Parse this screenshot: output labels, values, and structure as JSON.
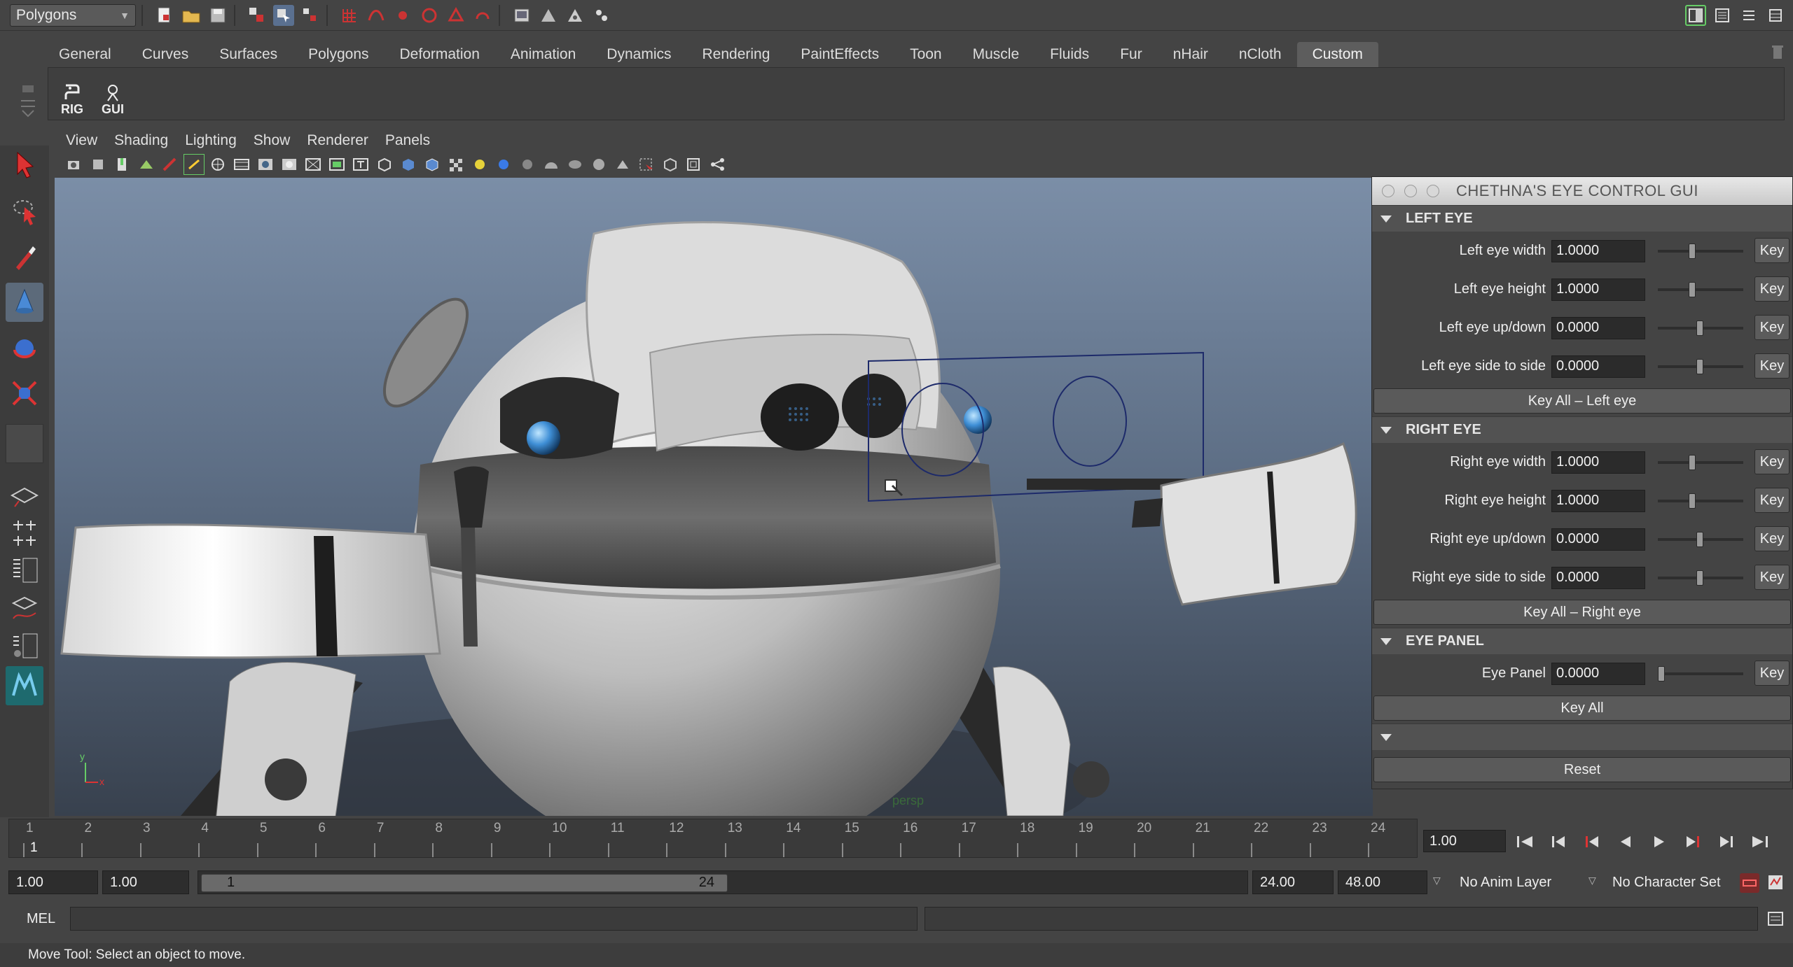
{
  "status_line": {
    "menu_set": "Polygons",
    "icons": [
      "new-scene-icon",
      "open-scene-icon",
      "save-scene-icon",
      "select-hierarchy-icon",
      "select-object-icon",
      "select-component-icon",
      "snap-grid-icon",
      "snap-curve-icon",
      "snap-point-icon",
      "snap-view-plane-icon",
      "snap-live-icon",
      "make-live-icon",
      "render-view-icon",
      "render-current-icon",
      "ipr-render-icon",
      "render-settings-icon"
    ],
    "right_icons": [
      "toggle-sidebar-icon",
      "attribute-editor-icon",
      "tool-settings-icon",
      "channel-box-icon"
    ]
  },
  "shelf": {
    "tabs": [
      "General",
      "Curves",
      "Surfaces",
      "Polygons",
      "Deformation",
      "Animation",
      "Dynamics",
      "Rendering",
      "PaintEffects",
      "Toon",
      "Muscle",
      "Fluids",
      "Fur",
      "nHair",
      "nCloth",
      "Custom"
    ],
    "active_tab": "Custom",
    "buttons": [
      {
        "label": "RIG",
        "icon": "python-script-icon"
      },
      {
        "label": "GUI",
        "icon": "mel-script-icon"
      }
    ]
  },
  "panel": {
    "menus": [
      "View",
      "Shading",
      "Lighting",
      "Show",
      "Renderer",
      "Panels"
    ],
    "camera_label": "persp"
  },
  "eye_gui": {
    "title": "CHETHNA'S EYE CONTROL GUI",
    "sections": [
      {
        "title": "LEFT EYE",
        "rows": [
          {
            "label": "Left eye width",
            "value": "1.0000",
            "slider": 0.4
          },
          {
            "label": "Left eye height",
            "value": "1.0000",
            "slider": 0.4
          },
          {
            "label": "Left eye up/down",
            "value": "0.0000",
            "slider": 0.5
          },
          {
            "label": "Left eye side to side",
            "value": "0.0000",
            "slider": 0.5
          }
        ],
        "key_all": "Key All – Left eye"
      },
      {
        "title": "RIGHT EYE",
        "rows": [
          {
            "label": "Right eye width",
            "value": "1.0000",
            "slider": 0.4
          },
          {
            "label": "Right eye height",
            "value": "1.0000",
            "slider": 0.4
          },
          {
            "label": "Right eye up/down",
            "value": "0.0000",
            "slider": 0.5
          },
          {
            "label": "Right eye side to side",
            "value": "0.0000",
            "slider": 0.5
          }
        ],
        "key_all": "Key All – Right eye"
      },
      {
        "title": "EYE PANEL",
        "rows": [
          {
            "label": "Eye Panel",
            "value": "0.0000",
            "slider": 0.0
          }
        ],
        "key_all": "Key All"
      }
    ],
    "key_label": "Key",
    "reset_label": "Reset"
  },
  "time_slider": {
    "frames": [
      "1",
      "2",
      "3",
      "4",
      "5",
      "6",
      "7",
      "8",
      "9",
      "10",
      "11",
      "12",
      "13",
      "14",
      "15",
      "16",
      "17",
      "18",
      "19",
      "20",
      "21",
      "22",
      "23",
      "24"
    ],
    "current_frame_mark": "1",
    "current_time": "1.00"
  },
  "range_slider": {
    "start_time": "1.00",
    "playback_start": "1.00",
    "range_min": "1",
    "range_max": "24",
    "playback_end": "24.00",
    "end_time": "48.00",
    "anim_layer": "No Anim Layer",
    "character_set": "No Character Set"
  },
  "command_line": {
    "label": "MEL"
  },
  "help_line": {
    "text": "Move Tool: Select an object to move."
  },
  "colors": {
    "accent": "#5c6a7a",
    "panel_bg": "#444444",
    "viewport_top": "#7b8ea7",
    "viewport_bottom": "#38414e"
  }
}
